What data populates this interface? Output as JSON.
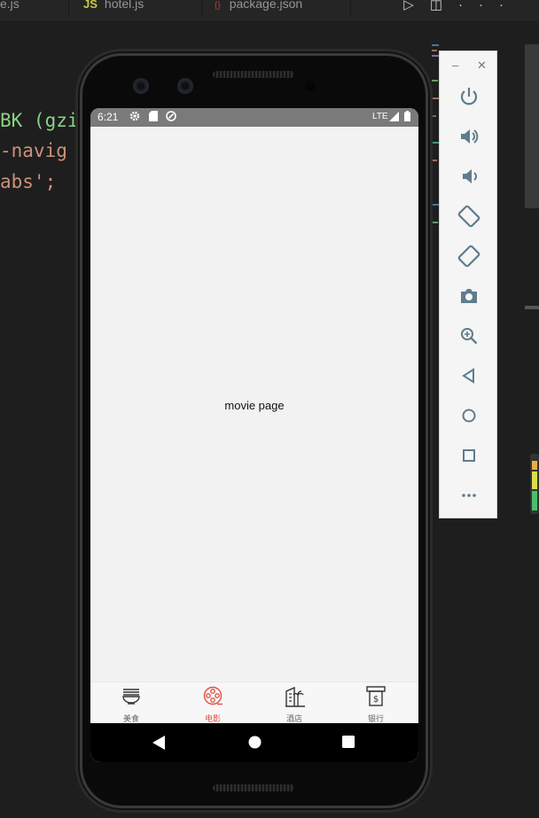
{
  "editor": {
    "tabs": [
      {
        "label": "e.js",
        "kind": "plain"
      },
      {
        "label": "hotel.js",
        "kind": "js",
        "badge": "JS"
      },
      {
        "label": "package.json",
        "kind": "json",
        "badge": "{}"
      }
    ],
    "code_lines": [
      {
        "text": "BK (gzi",
        "color": "#89d185"
      },
      {
        "text": "-navig",
        "color": "#ce9178"
      },
      {
        "text": "abs';",
        "color": "#ce9178"
      }
    ]
  },
  "phone": {
    "status": {
      "time": "6:21",
      "network": "LTE"
    },
    "page_text": "movie page",
    "tabs": [
      {
        "label": "美食",
        "icon": "noodle-bowl-icon",
        "active": false
      },
      {
        "label": "电影",
        "icon": "film-reel-icon",
        "active": true
      },
      {
        "label": "酒店",
        "icon": "hotel-building-icon",
        "active": false
      },
      {
        "label": "银行",
        "icon": "bank-atm-icon",
        "active": false
      }
    ],
    "colors": {
      "active_tab": "#e05040",
      "inactive_tab": "#333333",
      "statusbar": "#7a7a7a"
    }
  },
  "emulator_toolbar": {
    "items": [
      "power-icon",
      "volume-up-icon",
      "volume-down-icon",
      "rotate-left-icon",
      "rotate-right-icon",
      "screenshot-icon",
      "zoom-icon",
      "back-icon",
      "home-icon",
      "overview-icon",
      "more-icon"
    ]
  }
}
